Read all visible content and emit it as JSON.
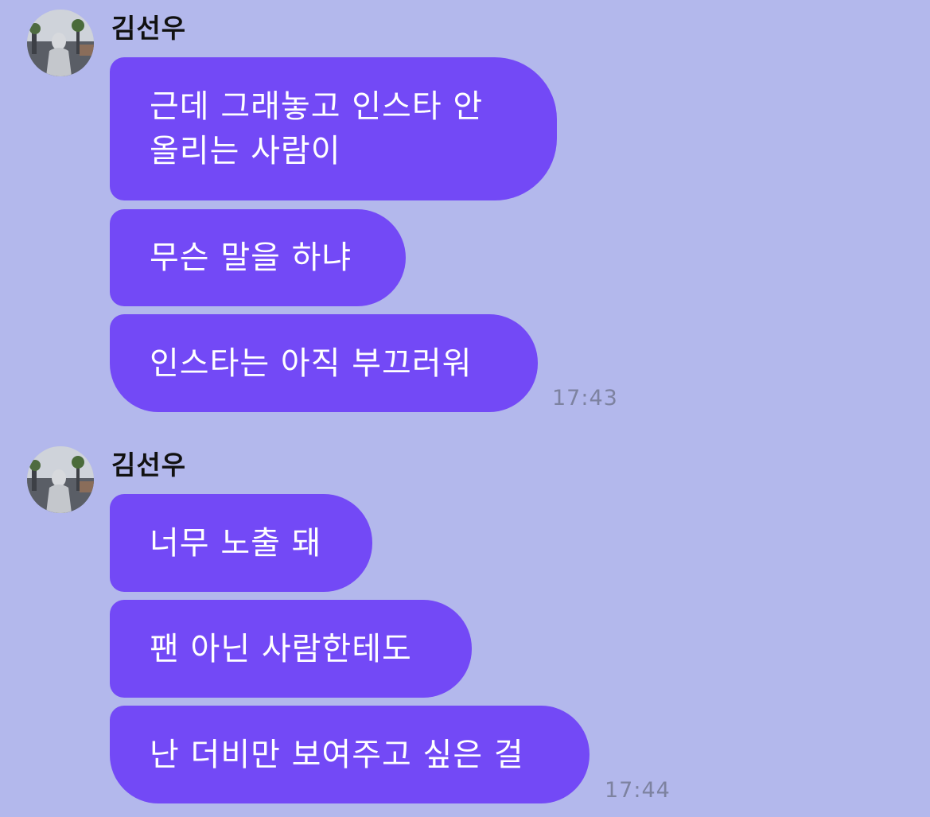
{
  "theme": {
    "background": "#b3b8ec",
    "bubble_color": "#7349f6",
    "bubble_text_color": "#ffffff",
    "timestamp_color": "#7d82a0"
  },
  "groups": [
    {
      "sender": "김선우",
      "avatar_icon": "profile-photo",
      "messages": [
        "근데 그래놓고 인스타 안\n올리는 사람이",
        "무슨 말을 하냐",
        "인스타는 아직 부끄러워"
      ],
      "time": "17:43"
    },
    {
      "sender": "김선우",
      "avatar_icon": "profile-photo",
      "messages": [
        "너무 노출 돼",
        "팬 아닌 사람한테도",
        "난 더비만 보여주고 싶은 걸"
      ],
      "time": "17:44"
    }
  ]
}
